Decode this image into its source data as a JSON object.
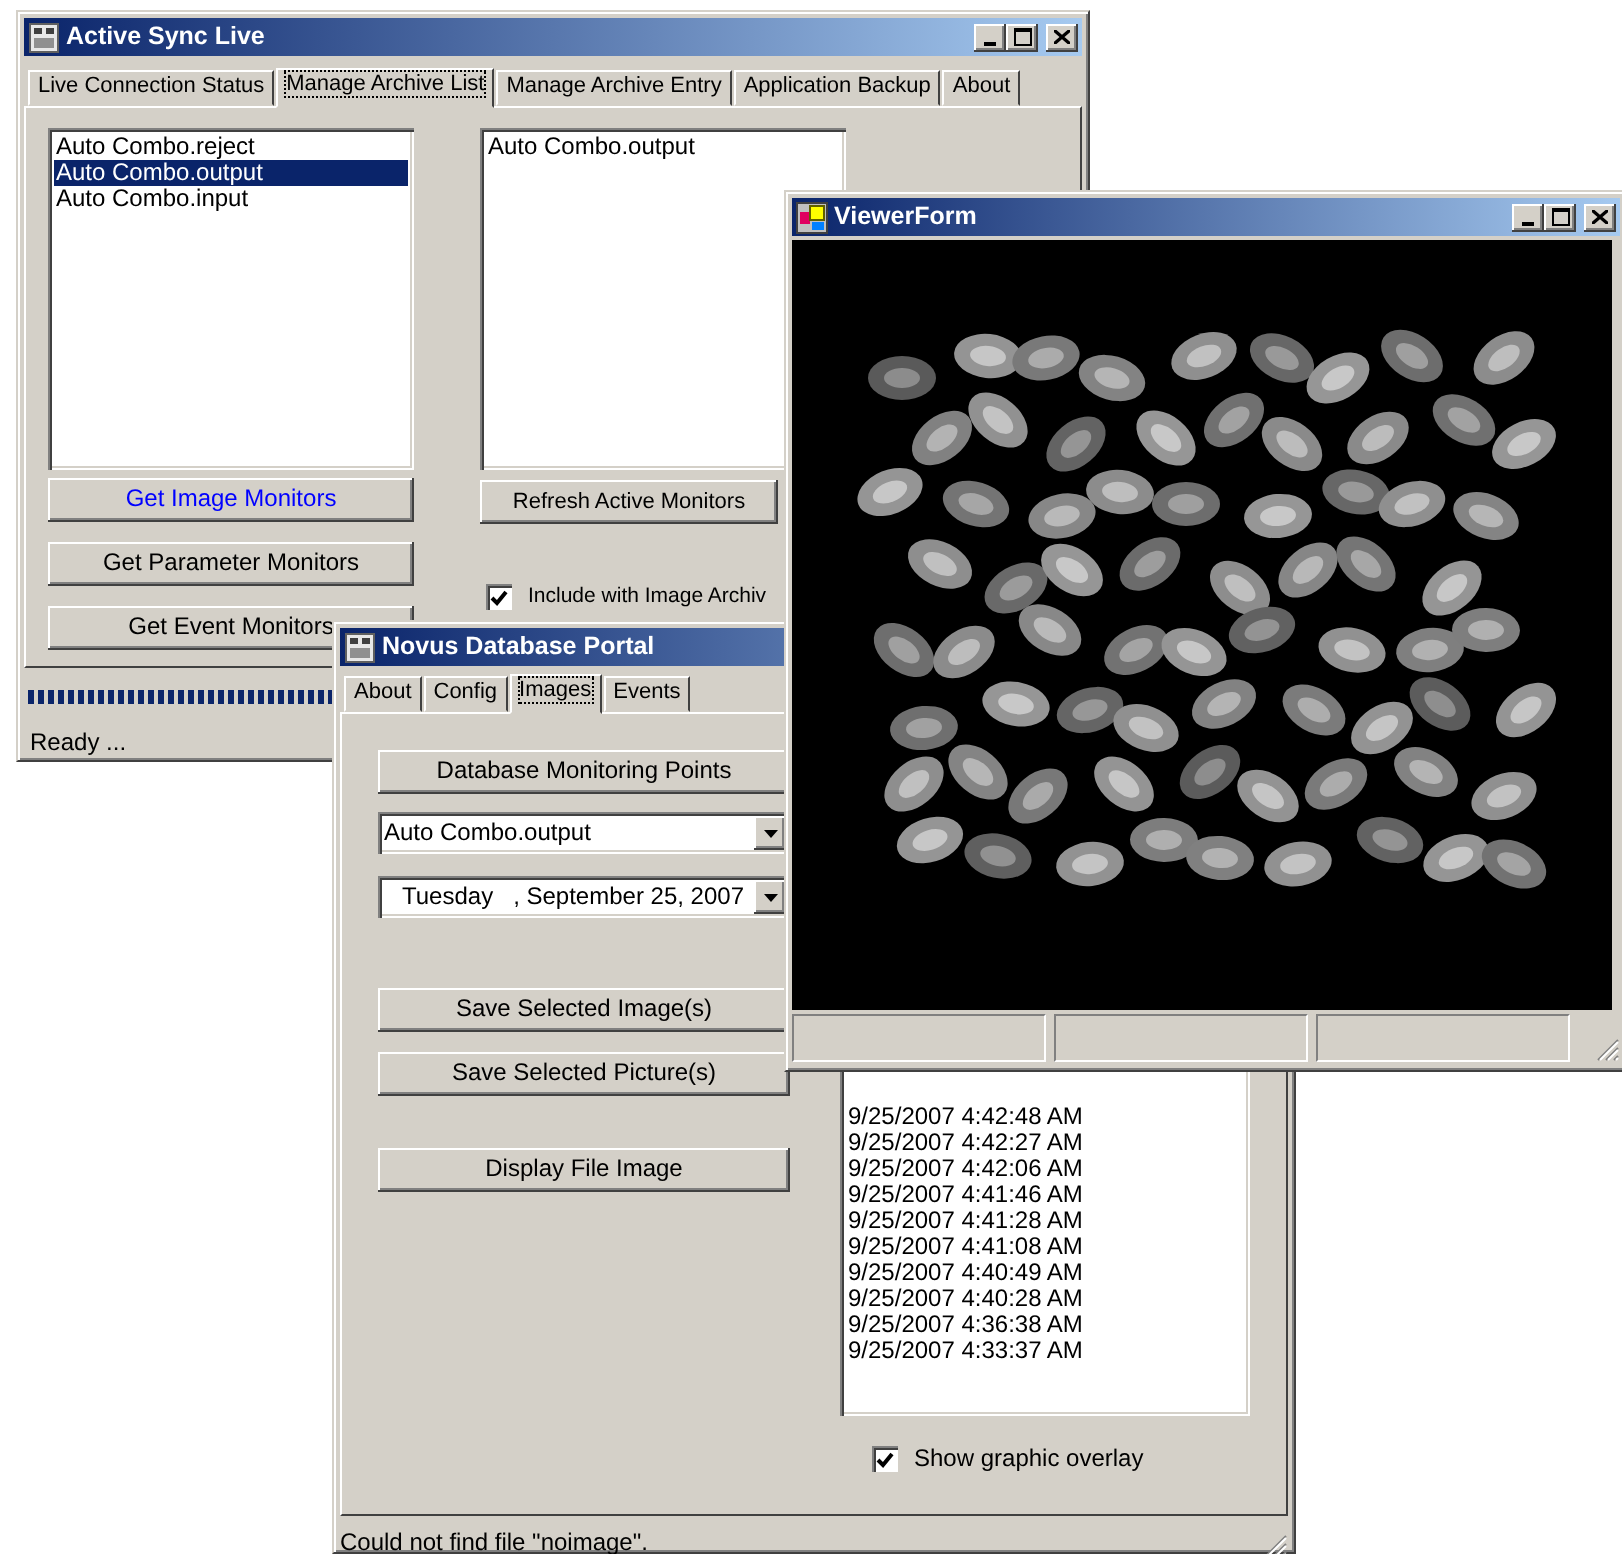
{
  "active_sync": {
    "title": "Active Sync Live",
    "tabs": [
      {
        "label": "Live Connection Status",
        "selected": false
      },
      {
        "label": "Manage Archive List",
        "selected": true
      },
      {
        "label": "Manage Archive Entry",
        "selected": false
      },
      {
        "label": "Application Backup",
        "selected": false
      },
      {
        "label": "About",
        "selected": false
      }
    ],
    "monitor_list": [
      {
        "text": "Auto Combo.reject",
        "selected": false
      },
      {
        "text": "Auto Combo.output",
        "selected": true
      },
      {
        "text": "Auto Combo.input",
        "selected": false
      }
    ],
    "archive_list": [
      "Auto Combo.output"
    ],
    "monitor_buttons": [
      {
        "label": "Get Image Monitors",
        "focused": true
      },
      {
        "label": "Get Parameter Monitors",
        "focused": false
      },
      {
        "label": "Get Event Monitors",
        "focused": false
      }
    ],
    "refresh_button": "Refresh Active Monitors",
    "include_checkbox": {
      "label": "Include with Image Archiv",
      "checked": true
    },
    "progress": {
      "level": 1
    },
    "status": "Ready ..."
  },
  "novus_portal": {
    "title": "Novus Database Portal",
    "tabs": [
      {
        "label": "About",
        "selected": false
      },
      {
        "label": "Config",
        "selected": false
      },
      {
        "label": "Images",
        "selected": true
      },
      {
        "label": "Events",
        "selected": false
      }
    ],
    "monitoring_points_button": "Database Monitoring Points",
    "point_combo": "Auto Combo.output",
    "date_picker": "Tuesday   , September 25, 2007",
    "save_buttons": [
      "Save Selected Image(s)",
      "Save Selected Picture(s)"
    ],
    "display_button": "Display File Image",
    "timestamps": [
      "9/25/2007 4:42:48 AM",
      "9/25/2007 4:42:27 AM",
      "9/25/2007 4:42:06 AM",
      "9/25/2007 4:41:46 AM",
      "9/25/2007 4:41:28 AM",
      "9/25/2007 4:41:08 AM",
      "9/25/2007 4:40:49 AM",
      "9/25/2007 4:40:28 AM",
      "9/25/2007 4:36:38 AM",
      "9/25/2007 4:33:37 AM"
    ],
    "overlay_checkbox": {
      "label": "Show graphic overlay",
      "checked": true
    },
    "status": "Could not find file \"noimage\"."
  },
  "viewer": {
    "title": "ViewerForm"
  }
}
